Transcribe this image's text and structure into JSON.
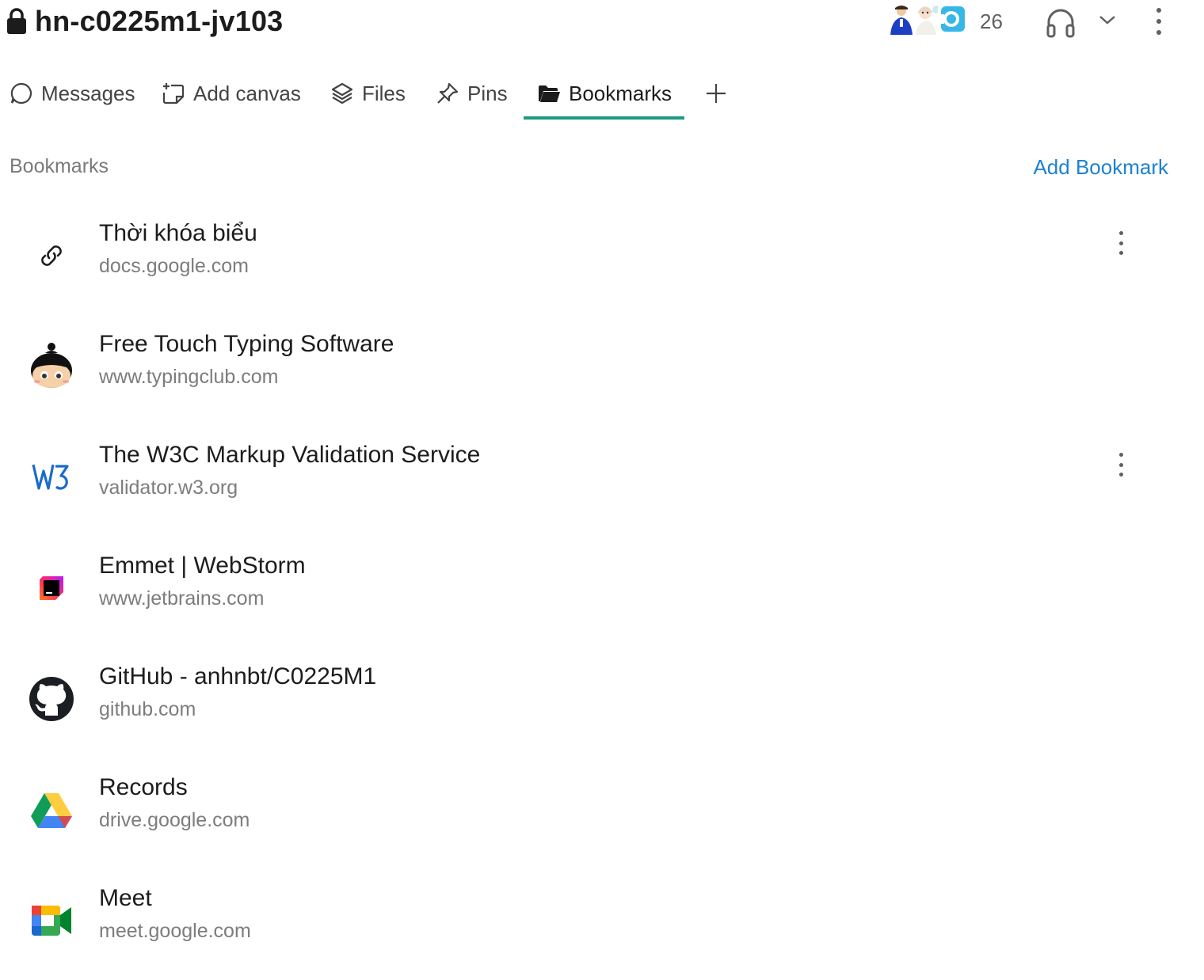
{
  "header": {
    "channel_name": "hn-c0225m1-jv103",
    "member_count": "26"
  },
  "tabs": [
    {
      "label": "Messages",
      "icon": "message-bubble-icon"
    },
    {
      "label": "Add canvas",
      "icon": "canvas-plus-icon"
    },
    {
      "label": "Files",
      "icon": "layers-icon"
    },
    {
      "label": "Pins",
      "icon": "pin-icon"
    },
    {
      "label": "Bookmarks",
      "icon": "folder-icon",
      "active": true
    }
  ],
  "bookmarks_section": {
    "label": "Bookmarks",
    "add_label": "Add Bookmark"
  },
  "bookmarks": [
    {
      "title": "Thời khóa biểu",
      "domain": "docs.google.com",
      "icon": "link-icon",
      "has_menu": true
    },
    {
      "title": "Free Touch Typing Software",
      "domain": "www.typingclub.com",
      "icon": "typingclub-icon",
      "has_menu": false
    },
    {
      "title": "The W3C Markup Validation Service",
      "domain": "validator.w3.org",
      "icon": "w3c-icon",
      "has_menu": true
    },
    {
      "title": "Emmet | WebStorm",
      "domain": "www.jetbrains.com",
      "icon": "jetbrains-icon",
      "has_menu": false
    },
    {
      "title": "GitHub - anhnbt/C0225M1",
      "domain": "github.com",
      "icon": "github-icon",
      "has_menu": false
    },
    {
      "title": "Records",
      "domain": "drive.google.com",
      "icon": "google-drive-icon",
      "has_menu": false
    },
    {
      "title": "Meet",
      "domain": "meet.google.com",
      "icon": "google-meet-icon",
      "has_menu": false
    }
  ],
  "colors": {
    "accent": "#1d9b82",
    "link": "#1d81d2",
    "muted": "#7d7c7e"
  }
}
